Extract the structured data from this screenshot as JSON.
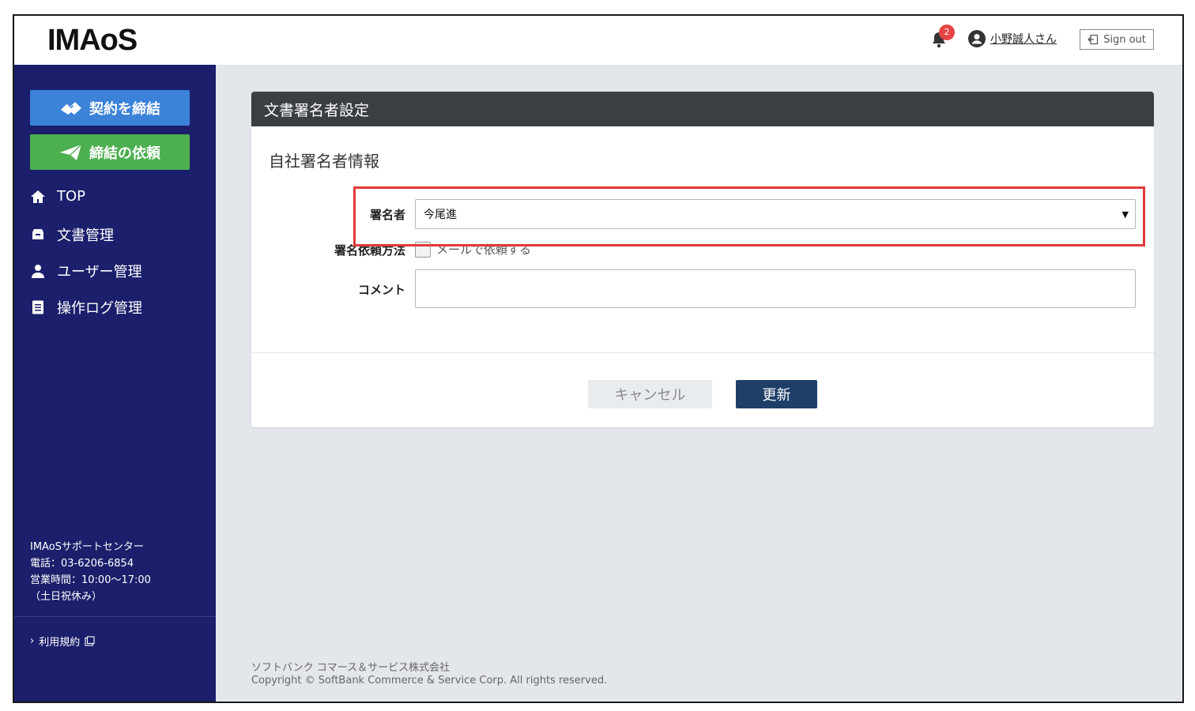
{
  "header": {
    "logo": "IMAoS",
    "notification_count": "2",
    "user_name": "小野誠人さん",
    "signout_label": "Sign out"
  },
  "sidebar": {
    "contract_button": "契約を締結",
    "request_button": "締結の依頼",
    "items": [
      {
        "label": "TOP",
        "icon": "home-icon"
      },
      {
        "label": "文書管理",
        "icon": "archive-icon"
      },
      {
        "label": "ユーザー管理",
        "icon": "user-icon"
      },
      {
        "label": "操作ログ管理",
        "icon": "document-icon"
      }
    ],
    "support": {
      "name": "IMAoSサポートセンター",
      "phone": "電話：03-6206-6854",
      "hours": "営業時間：10:00〜17:00",
      "holiday": "（土日祝休み）"
    },
    "terms_label": "利用規約"
  },
  "card": {
    "title": "文書署名者設定",
    "section_title": "自社署名者情報",
    "signer_label": "署名者",
    "signer_value": "今尾進",
    "method_label": "署名依頼方法",
    "method_option": "メールで依頼する",
    "comment_label": "コメント",
    "comment_value": "",
    "cancel_button": "キャンセル",
    "update_button": "更新"
  },
  "footer": {
    "company": "ソフトバンク コマース＆サービス株式会社",
    "copyright": "Copyright © SoftBank Commerce & Service Corp. All rights reserved."
  },
  "colors": {
    "sidebar_bg": "#1c1f6b",
    "contract_button": "#3b82d8",
    "request_button": "#4caf50",
    "update_button": "#1f3f68",
    "highlight": "#e03a3a",
    "badge": "#e64545"
  }
}
